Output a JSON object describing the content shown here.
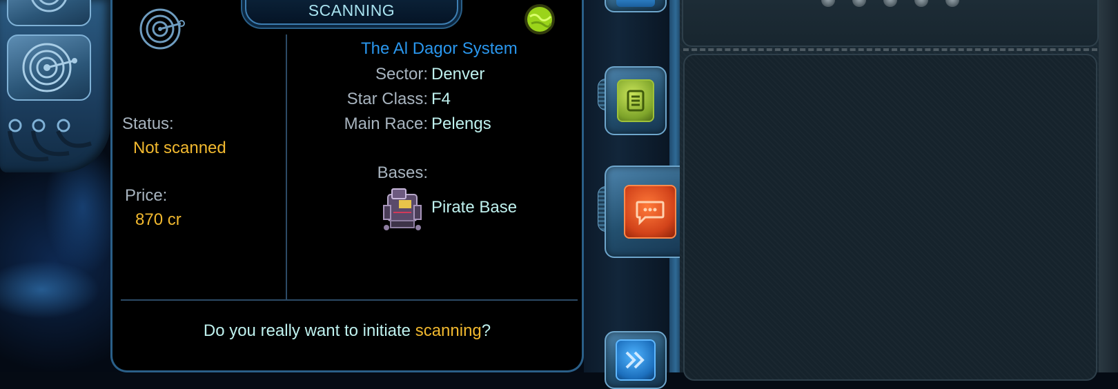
{
  "dialog": {
    "title": "SCANNING",
    "system_name": "The Al Dagor System",
    "status_label": "Status:",
    "status_value": "Not scanned",
    "price_label": "Price:",
    "price_value": "870 cr",
    "sector_label": "Sector:",
    "sector_value": "Denver",
    "star_class_label": "Star Class:",
    "star_class_value": "F4",
    "main_race_label": "Main Race:",
    "main_race_value": "Pelengs",
    "bases_label": "Bases:",
    "base_name": "Pirate Base",
    "question_prefix": "Do you really want to initiate ",
    "question_highlight": "scanning",
    "question_suffix": "?"
  },
  "icons": {
    "radar": "radar-icon",
    "planet": "planet-icon",
    "base": "pirate-base-icon",
    "notes": "notes-icon",
    "chat": "chat-icon",
    "next": "double-chevron-right-icon"
  },
  "colors": {
    "label": "#a8b4bf",
    "value": "#bff1ee",
    "highlight": "#f2b92f",
    "system_name": "#2a97ee",
    "frame": "#2a5f88"
  }
}
